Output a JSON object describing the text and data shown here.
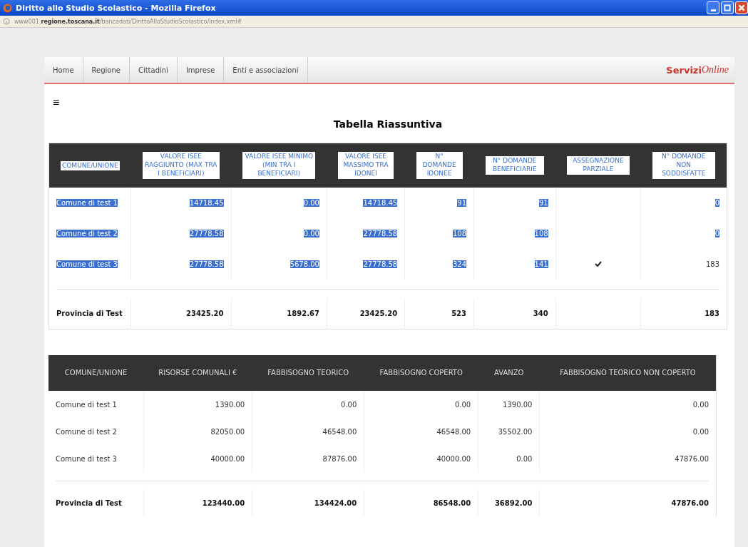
{
  "window": {
    "title": "Diritto allo Studio Scolastico - Mozilla Firefox"
  },
  "address_bar": {
    "prefix": "www001.",
    "domain": "regione.toscana.it",
    "path": "/bancadati/DirittoAlloStudioScolastico/index.xml#"
  },
  "nav": {
    "items": [
      {
        "label": "Home",
        "selected": false
      },
      {
        "label": "Regione",
        "selected": false
      },
      {
        "label": "Cittadini",
        "selected": false
      },
      {
        "label": "Imprese",
        "selected": false
      },
      {
        "label": "Enti e associazioni",
        "selected": false
      }
    ],
    "logo": {
      "bold": "Servizi",
      "italic": "Online"
    }
  },
  "menu_icon": "≡",
  "summary_title": "Tabella Riassuntiva",
  "table1": {
    "columns": [
      {
        "label": "COMUNE/UNIONE",
        "selected": true
      },
      {
        "label": "VALORE ISEE RAGGIUNTO (MAX TRA I BENEFICIARI)",
        "selected": true
      },
      {
        "label": "VALORE ISEE MINIMO (MIN TRA I BENEFICIARI)",
        "selected": true
      },
      {
        "label": "VALORE ISEE MASSIMO TRA IDONEI",
        "selected": true
      },
      {
        "label": "N° DOMANDE IDONEE",
        "selected": true
      },
      {
        "label": "N° DOMANDE BENEFICIARIE",
        "selected": true
      },
      {
        "label": "ASSEGNAZIONE PARZIALE",
        "selected": true
      },
      {
        "label": "N° DOMANDE NON SODDISFATTE",
        "selected": true
      }
    ],
    "rows": [
      {
        "cells": [
          {
            "text": "Comune di test 1",
            "selected": true
          },
          {
            "text": "14718.45",
            "selected": true
          },
          {
            "text": "0.00",
            "selected": true
          },
          {
            "text": "14718.45",
            "selected": true
          },
          {
            "text": "91",
            "selected": true
          },
          {
            "text": "91",
            "selected": true
          },
          {
            "kind": "check",
            "checked": false
          },
          {
            "text": "0",
            "selected": true
          }
        ]
      },
      {
        "cells": [
          {
            "text": "Comune di test 2",
            "selected": true
          },
          {
            "text": "27778.58",
            "selected": true
          },
          {
            "text": "0.00",
            "selected": true
          },
          {
            "text": "27778.58",
            "selected": true
          },
          {
            "text": "108",
            "selected": true
          },
          {
            "text": "108",
            "selected": true
          },
          {
            "kind": "check",
            "checked": false
          },
          {
            "text": "0",
            "selected": true
          }
        ]
      },
      {
        "cells": [
          {
            "text": "Comune di test 3",
            "selected": true
          },
          {
            "text": "27778.58",
            "selected": true
          },
          {
            "text": "5678.00",
            "selected": true
          },
          {
            "text": "27778.58",
            "selected": true
          },
          {
            "text": "324",
            "selected": true
          },
          {
            "text": "141",
            "selected": true
          },
          {
            "kind": "check",
            "checked": true
          },
          {
            "text": "183",
            "selected": false
          }
        ]
      }
    ],
    "total": [
      {
        "kind": "text",
        "text": "Provincia di Test"
      },
      {
        "kind": "text",
        "text": "23425.20"
      },
      {
        "kind": "text",
        "text": "1892.67"
      },
      {
        "kind": "text",
        "text": "23425.20"
      },
      {
        "kind": "text",
        "text": "523"
      },
      {
        "kind": "text",
        "text": "340"
      },
      {
        "kind": "empty"
      },
      {
        "kind": "text",
        "text": "183"
      }
    ]
  },
  "table2": {
    "columns": [
      "COMUNE/UNIONE",
      "RISORSE COMUNALI €",
      "FABBISOGNO TEORICO",
      "FABBISOGNO COPERTO",
      "AVANZO",
      "FABBISOGNO TEORICO NON COPERTO"
    ],
    "rows": [
      [
        "Comune di test 1",
        "1390.00",
        "0.00",
        "0.00",
        "1390.00",
        "0.00"
      ],
      [
        "Comune di test 2",
        "82050.00",
        "46548.00",
        "46548.00",
        "35502.00",
        "0.00"
      ],
      [
        "Comune di test 3",
        "40000.00",
        "87876.00",
        "40000.00",
        "0.00",
        "47876.00"
      ]
    ],
    "total": [
      "Provincia di Test",
      "123440.00",
      "134424.00",
      "86548.00",
      "36892.00",
      "47876.00"
    ]
  }
}
